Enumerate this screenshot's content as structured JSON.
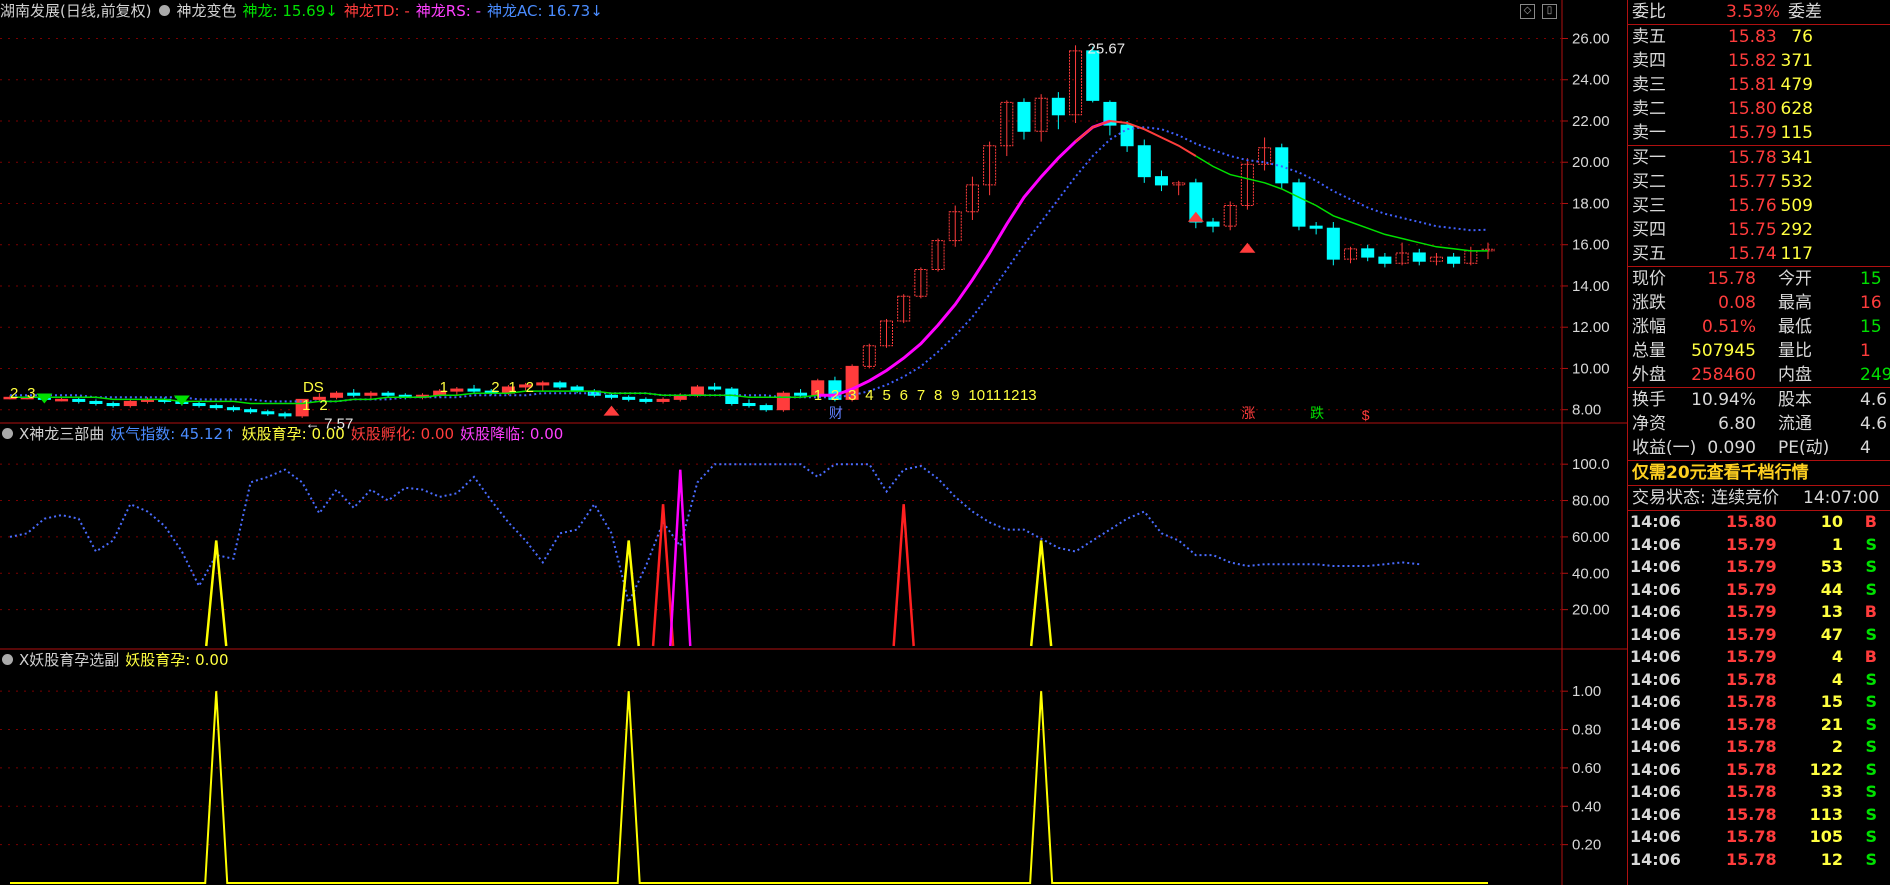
{
  "colors": {
    "up": "#ff3c3c",
    "down": "#00ffff",
    "ma_green": "#00e000",
    "ma_blue": "#4060ff",
    "magenta": "#ff00ff",
    "yellow": "#ffff00",
    "grid": "#7a0000",
    "axis": "#b01010"
  },
  "header_main": {
    "title": "湖南发展(日线,前复权)",
    "indicator": "神龙变色",
    "shenlong": "神龙: 15.69↓",
    "td": "神龙TD: -",
    "rs": "神龙RS: -",
    "ac": "神龙AC: 16.73↓"
  },
  "header_sub1": {
    "title": "X神龙三部曲",
    "yaoqi": "妖气指数: 45.12↑",
    "yuyun": "妖股育孕: 0.00",
    "fuhua": "妖股孵化: 0.00",
    "jianglin": "妖股降临: 0.00"
  },
  "header_sub2": {
    "title": "X妖股育孕选副",
    "yuyun": "妖股育孕: 0.00"
  },
  "annotations": {
    "high": "25.67",
    "low": "7.57",
    "count_labels": [
      "1",
      "2",
      "3",
      "4",
      "5",
      "6",
      "7",
      "8",
      "9",
      "10",
      "11",
      "12",
      "13"
    ],
    "early_labels": [
      "2",
      "3",
      "1",
      "2",
      "1",
      "2",
      "1",
      "2",
      "DS"
    ],
    "markers": [
      "财",
      "涨",
      "跌",
      "$"
    ]
  },
  "chart_data": [
    {
      "type": "candlestick",
      "title": "湖南发展(日线,前复权)",
      "ylim": [
        7.5,
        26.8
      ],
      "yticks": [
        "26.00",
        "24.00",
        "22.00",
        "20.00",
        "18.00",
        "16.00",
        "14.00",
        "12.00",
        "10.00",
        "8.00"
      ],
      "ohlc": [
        [
          8.6,
          8.7,
          8.5,
          8.6
        ],
        [
          8.6,
          8.7,
          8.5,
          8.6
        ],
        [
          8.6,
          8.7,
          8.4,
          8.5
        ],
        [
          8.5,
          8.6,
          8.4,
          8.5
        ],
        [
          8.5,
          8.6,
          8.3,
          8.4
        ],
        [
          8.4,
          8.5,
          8.2,
          8.3
        ],
        [
          8.3,
          8.4,
          8.1,
          8.2
        ],
        [
          8.2,
          8.5,
          8.1,
          8.4
        ],
        [
          8.4,
          8.6,
          8.3,
          8.5
        ],
        [
          8.5,
          8.6,
          8.3,
          8.4
        ],
        [
          8.4,
          8.5,
          8.2,
          8.3
        ],
        [
          8.3,
          8.4,
          8.1,
          8.2
        ],
        [
          8.2,
          8.3,
          8.0,
          8.1
        ],
        [
          8.1,
          8.2,
          7.9,
          8.0
        ],
        [
          8.0,
          8.1,
          7.8,
          7.9
        ],
        [
          7.9,
          8.0,
          7.7,
          7.8
        ],
        [
          7.8,
          7.9,
          7.57,
          7.7
        ],
        [
          7.7,
          8.5,
          7.6,
          8.5
        ],
        [
          8.5,
          8.8,
          8.4,
          8.6
        ],
        [
          8.6,
          8.9,
          8.5,
          8.8
        ],
        [
          8.8,
          9.0,
          8.6,
          8.7
        ],
        [
          8.7,
          8.9,
          8.5,
          8.8
        ],
        [
          8.8,
          8.9,
          8.6,
          8.7
        ],
        [
          8.7,
          8.8,
          8.5,
          8.6
        ],
        [
          8.6,
          8.8,
          8.5,
          8.7
        ],
        [
          8.7,
          9.0,
          8.6,
          8.9
        ],
        [
          8.9,
          9.1,
          8.7,
          9.0
        ],
        [
          9.0,
          9.2,
          8.8,
          8.9
        ],
        [
          8.9,
          9.0,
          8.7,
          8.8
        ],
        [
          8.8,
          9.2,
          8.7,
          9.1
        ],
        [
          9.1,
          9.3,
          8.9,
          9.2
        ],
        [
          9.2,
          9.4,
          8.9,
          9.3
        ],
        [
          9.3,
          9.4,
          9.0,
          9.1
        ],
        [
          9.1,
          9.2,
          8.8,
          8.9
        ],
        [
          8.9,
          9.0,
          8.6,
          8.7
        ],
        [
          8.7,
          8.8,
          8.5,
          8.6
        ],
        [
          8.6,
          8.7,
          8.4,
          8.5
        ],
        [
          8.5,
          8.6,
          8.3,
          8.4
        ],
        [
          8.4,
          8.6,
          8.3,
          8.5
        ],
        [
          8.5,
          8.8,
          8.4,
          8.7
        ],
        [
          8.7,
          9.2,
          8.6,
          9.1
        ],
        [
          9.1,
          9.3,
          8.9,
          9.0
        ],
        [
          9.0,
          9.1,
          8.2,
          8.3
        ],
        [
          8.3,
          8.5,
          8.1,
          8.2
        ],
        [
          8.2,
          8.3,
          7.9,
          8.0
        ],
        [
          8.0,
          8.9,
          7.9,
          8.8
        ],
        [
          8.8,
          9.0,
          8.6,
          8.7
        ],
        [
          8.7,
          9.5,
          8.6,
          9.4
        ],
        [
          9.4,
          9.6,
          8.4,
          8.5
        ],
        [
          8.5,
          10.2,
          8.4,
          10.1
        ],
        [
          10.1,
          11.2,
          10.0,
          11.1
        ],
        [
          11.1,
          12.4,
          11.0,
          12.3
        ],
        [
          12.3,
          13.6,
          12.2,
          13.5
        ],
        [
          13.5,
          14.9,
          13.4,
          14.8
        ],
        [
          14.8,
          16.3,
          14.7,
          16.2
        ],
        [
          16.2,
          17.9,
          15.9,
          17.6
        ],
        [
          17.6,
          19.3,
          17.2,
          18.9
        ],
        [
          18.9,
          21.0,
          18.4,
          20.8
        ],
        [
          20.8,
          23.0,
          20.3,
          22.9
        ],
        [
          22.9,
          23.1,
          21.1,
          21.5
        ],
        [
          21.5,
          23.3,
          21.0,
          23.1
        ],
        [
          23.1,
          23.4,
          21.6,
          22.3
        ],
        [
          22.3,
          25.67,
          21.9,
          25.4
        ],
        [
          25.4,
          25.6,
          22.9,
          23.0
        ],
        [
          22.9,
          23.0,
          21.3,
          21.8
        ],
        [
          21.8,
          22.0,
          20.5,
          20.8
        ],
        [
          20.8,
          21.1,
          19.0,
          19.3
        ],
        [
          19.3,
          19.6,
          18.6,
          18.9
        ],
        [
          18.9,
          19.1,
          18.4,
          19.0
        ],
        [
          19.0,
          19.2,
          16.8,
          17.1
        ],
        [
          17.1,
          17.3,
          16.6,
          16.9
        ],
        [
          16.9,
          18.1,
          16.7,
          17.9
        ],
        [
          17.9,
          20.2,
          17.7,
          19.9
        ],
        [
          19.9,
          21.2,
          19.6,
          20.7
        ],
        [
          20.7,
          20.9,
          18.7,
          19.0
        ],
        [
          19.0,
          19.2,
          16.7,
          16.9
        ],
        [
          16.9,
          17.1,
          16.5,
          16.8
        ],
        [
          16.8,
          17.1,
          15.0,
          15.3
        ],
        [
          15.3,
          15.9,
          15.1,
          15.8
        ],
        [
          15.8,
          16.0,
          15.2,
          15.4
        ],
        [
          15.4,
          15.6,
          14.9,
          15.1
        ],
        [
          15.1,
          16.1,
          15.0,
          15.6
        ],
        [
          15.6,
          15.8,
          15.0,
          15.2
        ],
        [
          15.2,
          15.6,
          15.0,
          15.4
        ],
        [
          15.4,
          15.6,
          14.9,
          15.1
        ],
        [
          15.1,
          15.9,
          15.0,
          15.7
        ],
        [
          15.7,
          16.1,
          15.3,
          15.78
        ]
      ],
      "ma_green": [
        8.6,
        8.6,
        8.6,
        8.6,
        8.6,
        8.6,
        8.5,
        8.5,
        8.5,
        8.5,
        8.4,
        8.4,
        8.4,
        8.4,
        8.3,
        8.3,
        8.3,
        8.3,
        8.4,
        8.4,
        8.5,
        8.5,
        8.6,
        8.6,
        8.6,
        8.7,
        8.7,
        8.8,
        8.8,
        8.8,
        8.9,
        8.9,
        8.9,
        8.9,
        8.9,
        8.8,
        8.8,
        8.8,
        8.7,
        8.7,
        8.7,
        8.7,
        8.7,
        8.6,
        8.6,
        8.6,
        8.6,
        8.7,
        8.7,
        9.0,
        9.4,
        9.9,
        10.5,
        11.2,
        12.1,
        13.1,
        14.3,
        15.6,
        17.0,
        18.3,
        19.3,
        20.2,
        21.0,
        21.7,
        22.0,
        21.9,
        21.6,
        21.2,
        20.8,
        20.3,
        19.8,
        19.4,
        19.2,
        19.0,
        18.7,
        18.3,
        17.9,
        17.4,
        17.1,
        16.8,
        16.5,
        16.3,
        16.1,
        15.9,
        15.8,
        15.7,
        15.7
      ],
      "ma_blue": [
        8.7,
        8.7,
        8.7,
        8.7,
        8.7,
        8.6,
        8.6,
        8.6,
        8.6,
        8.6,
        8.6,
        8.5,
        8.5,
        8.5,
        8.5,
        8.4,
        8.4,
        8.4,
        8.4,
        8.4,
        8.5,
        8.5,
        8.5,
        8.6,
        8.6,
        8.6,
        8.6,
        8.7,
        8.7,
        8.7,
        8.7,
        8.8,
        8.8,
        8.8,
        8.8,
        8.8,
        8.8,
        8.8,
        8.7,
        8.7,
        8.7,
        8.7,
        8.7,
        8.7,
        8.7,
        8.6,
        8.6,
        8.6,
        8.6,
        8.7,
        8.9,
        9.2,
        9.6,
        10.1,
        10.8,
        11.6,
        12.5,
        13.6,
        14.8,
        16.0,
        17.1,
        18.2,
        19.3,
        20.3,
        21.1,
        21.6,
        21.7,
        21.6,
        21.3,
        20.9,
        20.6,
        20.3,
        20.1,
        20.0,
        19.8,
        19.5,
        19.1,
        18.6,
        18.2,
        17.8,
        17.5,
        17.3,
        17.1,
        16.9,
        16.8,
        16.7,
        16.73
      ],
      "magenta_from": 47
    },
    {
      "type": "line",
      "title": "X神龙三部曲",
      "ylim": [
        0,
        110
      ],
      "yticks": [
        "100.0",
        "80.00",
        "60.00",
        "40.00",
        "20.00"
      ],
      "series": [
        {
          "name": "妖气指数",
          "values": [
            60,
            62,
            70,
            72,
            70,
            52,
            58,
            78,
            74,
            66,
            52,
            33,
            50,
            48,
            90,
            93,
            97,
            90,
            73,
            86,
            76,
            86,
            80,
            87,
            86,
            82,
            84,
            93,
            80,
            68,
            58,
            46,
            62,
            64,
            78,
            62,
            24,
            44,
            68,
            55,
            90,
            100,
            100,
            100,
            100,
            100,
            100,
            93,
            100,
            100,
            100,
            85,
            97,
            99,
            92,
            82,
            74,
            68,
            64,
            64,
            59,
            54,
            52,
            58,
            64,
            70,
            74,
            62,
            58,
            50,
            50,
            46,
            44,
            45,
            45,
            45,
            45,
            44,
            44,
            44,
            45,
            46,
            45
          ]
        },
        {
          "name": "妖股育孕",
          "peaks": [
            12,
            36,
            60
          ]
        },
        {
          "name": "妖股孵化",
          "peaks": [
            38,
            52
          ]
        },
        {
          "name": "妖股降临",
          "peaks": [
            39
          ]
        }
      ]
    },
    {
      "type": "line",
      "title": "X妖股育孕选副",
      "ylim": [
        0,
        1.1
      ],
      "yticks": [
        "1.00",
        "0.80",
        "0.60",
        "0.40",
        "0.20"
      ],
      "series": [
        {
          "name": "妖股育孕",
          "peaks": [
            12,
            36,
            60
          ]
        }
      ]
    }
  ],
  "quote": {
    "weibi_label": "委比",
    "weibi_value": "3.53%",
    "weicha_label": "委差",
    "asks": [
      {
        "label": "卖五",
        "price": "15.83",
        "vol": "76"
      },
      {
        "label": "卖四",
        "price": "15.82",
        "vol": "371"
      },
      {
        "label": "卖三",
        "price": "15.81",
        "vol": "479"
      },
      {
        "label": "卖二",
        "price": "15.80",
        "vol": "628"
      },
      {
        "label": "卖一",
        "price": "15.79",
        "vol": "115"
      }
    ],
    "bids": [
      {
        "label": "买一",
        "price": "15.78",
        "vol": "341"
      },
      {
        "label": "买二",
        "price": "15.77",
        "vol": "532"
      },
      {
        "label": "买三",
        "price": "15.76",
        "vol": "509"
      },
      {
        "label": "买四",
        "price": "15.75",
        "vol": "292"
      },
      {
        "label": "买五",
        "price": "15.74",
        "vol": "117"
      }
    ],
    "stats": [
      {
        "l1": "现价",
        "v1": "15.78",
        "c1": "r",
        "l2": "今开",
        "v2": "15",
        "c2": "g"
      },
      {
        "l1": "涨跌",
        "v1": "0.08",
        "c1": "r",
        "l2": "最高",
        "v2": "16",
        "c2": "r"
      },
      {
        "l1": "涨幅",
        "v1": "0.51%",
        "c1": "r",
        "l2": "最低",
        "v2": "15",
        "c2": "g"
      },
      {
        "l1": "总量",
        "v1": "507945",
        "c1": "y",
        "l2": "量比",
        "v2": "1",
        "c2": "r"
      },
      {
        "l1": "外盘",
        "v1": "258460",
        "c1": "r",
        "l2": "内盘",
        "v2": "249",
        "c2": "g"
      }
    ],
    "stats2": [
      {
        "l1": "换手",
        "v1": "10.94%",
        "l2": "股本",
        "v2": "4.6"
      },
      {
        "l1": "净资",
        "v1": "6.80",
        "l2": "流通",
        "v2": "4.6"
      },
      {
        "l1": "收益(一)",
        "v1": "0.090",
        "l2": "PE(动)",
        "v2": "4"
      }
    ],
    "promo": "仅需20元查看千档行情",
    "status_label": "交易状态: 连续竞价",
    "status_time": "14:07:00",
    "ticks": [
      {
        "t": "14:06",
        "p": "15.80",
        "v": "10",
        "s": "B"
      },
      {
        "t": "14:06",
        "p": "15.79",
        "v": "1",
        "s": "S"
      },
      {
        "t": "14:06",
        "p": "15.79",
        "v": "53",
        "s": "S"
      },
      {
        "t": "14:06",
        "p": "15.79",
        "v": "44",
        "s": "S"
      },
      {
        "t": "14:06",
        "p": "15.79",
        "v": "13",
        "s": "B"
      },
      {
        "t": "14:06",
        "p": "15.79",
        "v": "47",
        "s": "S"
      },
      {
        "t": "14:06",
        "p": "15.79",
        "v": "4",
        "s": "B"
      },
      {
        "t": "14:06",
        "p": "15.78",
        "v": "4",
        "s": "S"
      },
      {
        "t": "14:06",
        "p": "15.78",
        "v": "15",
        "s": "S"
      },
      {
        "t": "14:06",
        "p": "15.78",
        "v": "21",
        "s": "S"
      },
      {
        "t": "14:06",
        "p": "15.78",
        "v": "2",
        "s": "S"
      },
      {
        "t": "14:06",
        "p": "15.78",
        "v": "122",
        "s": "S"
      },
      {
        "t": "14:06",
        "p": "15.78",
        "v": "33",
        "s": "S"
      },
      {
        "t": "14:06",
        "p": "15.78",
        "v": "113",
        "s": "S"
      },
      {
        "t": "14:06",
        "p": "15.78",
        "v": "105",
        "s": "S"
      },
      {
        "t": "14:06",
        "p": "15.78",
        "v": "12",
        "s": "S"
      }
    ]
  }
}
